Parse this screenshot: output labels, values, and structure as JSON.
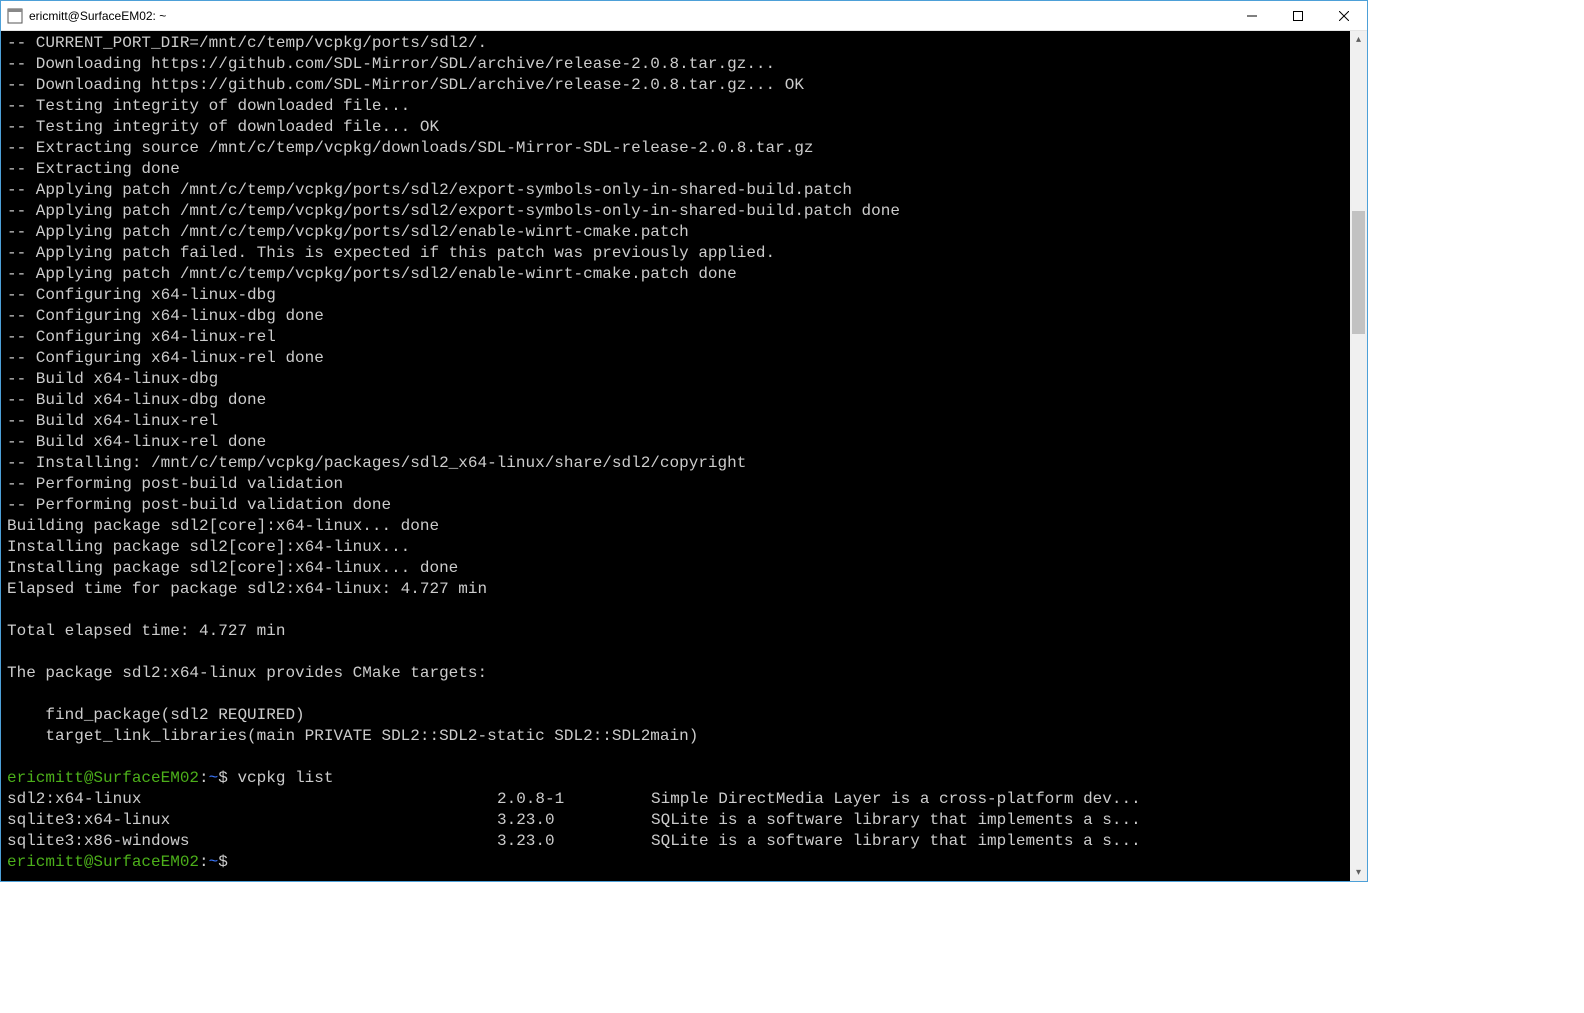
{
  "window": {
    "title": "ericmitt@SurfaceEM02: ~"
  },
  "prompt": {
    "user_host": "ericmitt@SurfaceEM02",
    "colon": ":",
    "path": "~",
    "dollar": "$"
  },
  "commands": {
    "vcpkg_list": "vcpkg list"
  },
  "output_lines": [
    "-- CURRENT_PORT_DIR=/mnt/c/temp/vcpkg/ports/sdl2/.",
    "-- Downloading https://github.com/SDL-Mirror/SDL/archive/release-2.0.8.tar.gz...",
    "-- Downloading https://github.com/SDL-Mirror/SDL/archive/release-2.0.8.tar.gz... OK",
    "-- Testing integrity of downloaded file...",
    "-- Testing integrity of downloaded file... OK",
    "-- Extracting source /mnt/c/temp/vcpkg/downloads/SDL-Mirror-SDL-release-2.0.8.tar.gz",
    "-- Extracting done",
    "-- Applying patch /mnt/c/temp/vcpkg/ports/sdl2/export-symbols-only-in-shared-build.patch",
    "-- Applying patch /mnt/c/temp/vcpkg/ports/sdl2/export-symbols-only-in-shared-build.patch done",
    "-- Applying patch /mnt/c/temp/vcpkg/ports/sdl2/enable-winrt-cmake.patch",
    "-- Applying patch failed. This is expected if this patch was previously applied.",
    "-- Applying patch /mnt/c/temp/vcpkg/ports/sdl2/enable-winrt-cmake.patch done",
    "-- Configuring x64-linux-dbg",
    "-- Configuring x64-linux-dbg done",
    "-- Configuring x64-linux-rel",
    "-- Configuring x64-linux-rel done",
    "-- Build x64-linux-dbg",
    "-- Build x64-linux-dbg done",
    "-- Build x64-linux-rel",
    "-- Build x64-linux-rel done",
    "-- Installing: /mnt/c/temp/vcpkg/packages/sdl2_x64-linux/share/sdl2/copyright",
    "-- Performing post-build validation",
    "-- Performing post-build validation done",
    "Building package sdl2[core]:x64-linux... done",
    "Installing package sdl2[core]:x64-linux...",
    "Installing package sdl2[core]:x64-linux... done",
    "Elapsed time for package sdl2:x64-linux: 4.727 min",
    "",
    "Total elapsed time: 4.727 min",
    "",
    "The package sdl2:x64-linux provides CMake targets:",
    "",
    "    find_package(sdl2 REQUIRED)",
    "    target_link_libraries(main PRIVATE SDL2::SDL2-static SDL2::SDL2main)",
    ""
  ],
  "list_rows": [
    {
      "name": "sdl2:x64-linux",
      "version": "2.0.8-1",
      "desc": "Simple DirectMedia Layer is a cross-platform dev..."
    },
    {
      "name": "sqlite3:x64-linux",
      "version": "3.23.0",
      "desc": "SQLite is a software library that implements a s..."
    },
    {
      "name": "sqlite3:x86-windows",
      "version": "3.23.0",
      "desc": "SQLite is a software library that implements a s..."
    }
  ]
}
